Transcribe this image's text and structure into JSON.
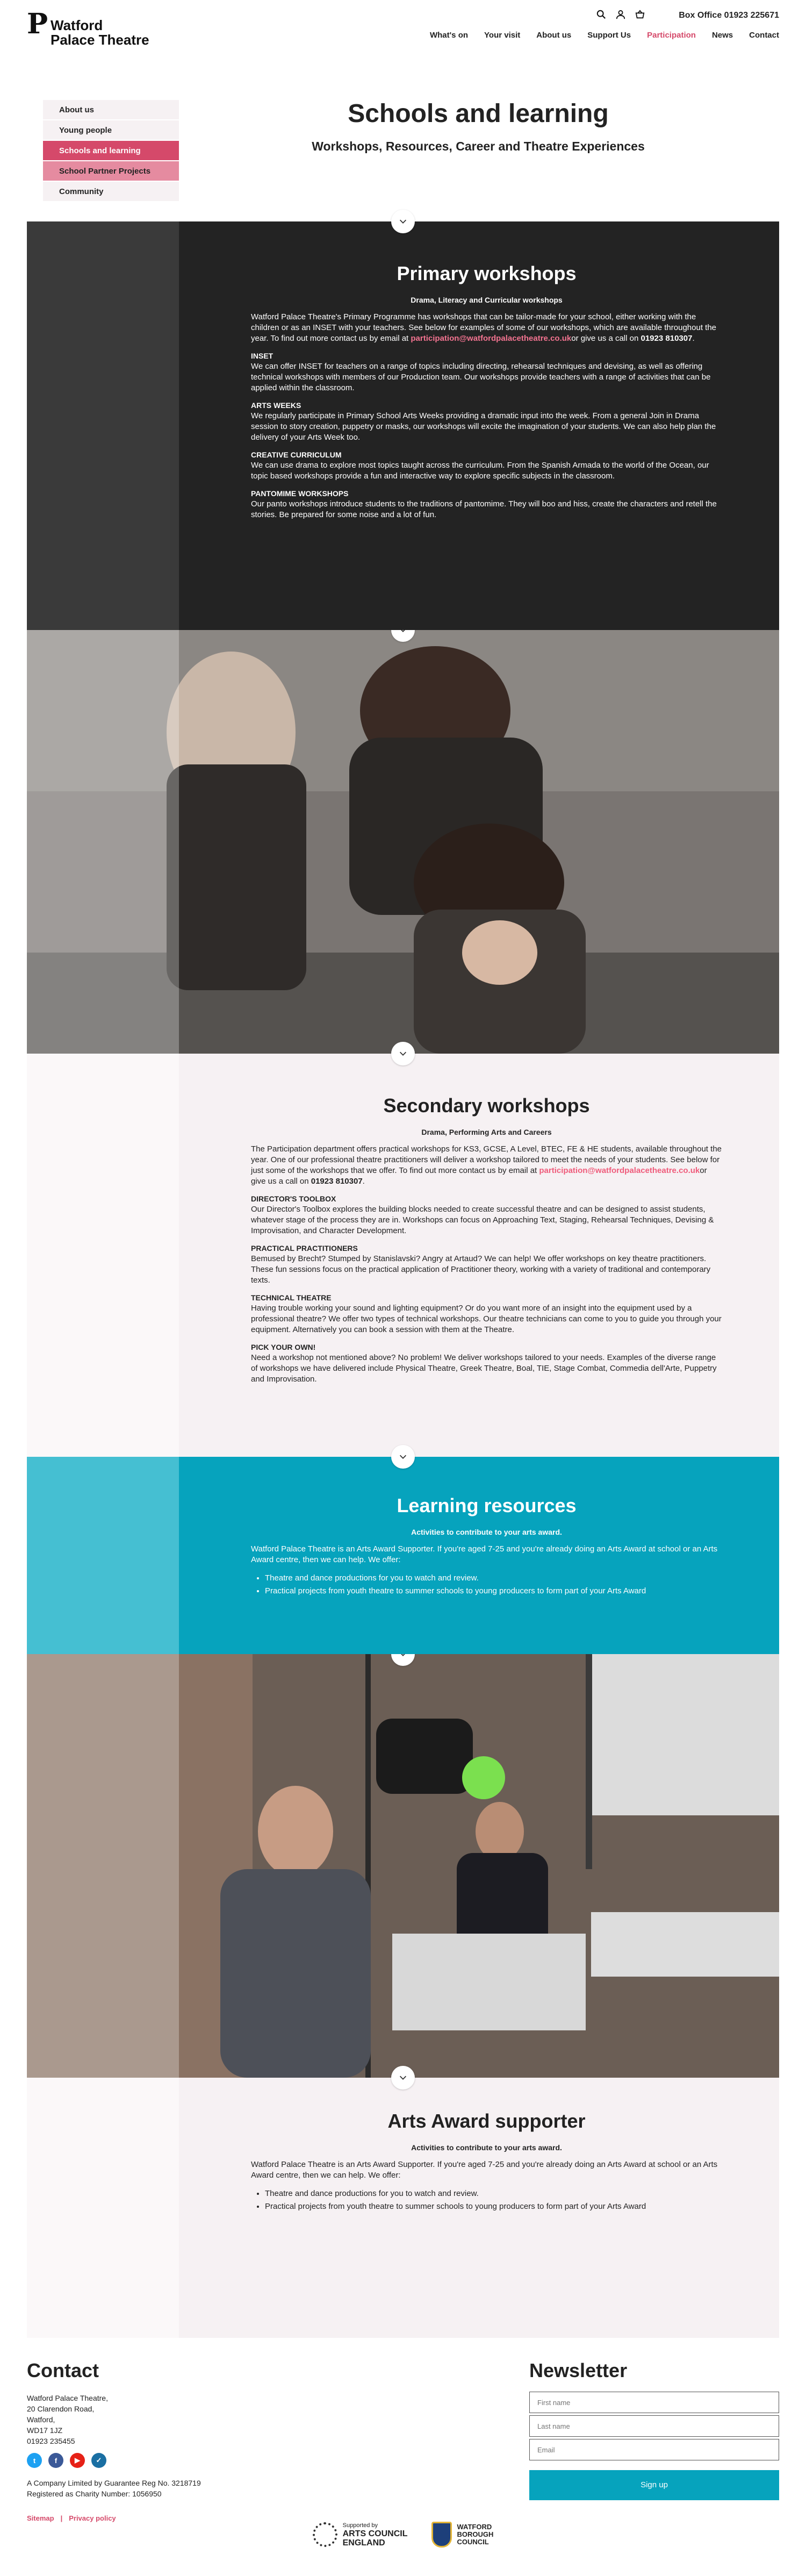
{
  "header": {
    "logo_mark": "P",
    "logo_line1": "Watford",
    "logo_line2": "Palace Theatre",
    "box_office": "Box Office 01923 225671",
    "icons": [
      "search-icon",
      "user-icon",
      "basket-icon"
    ],
    "nav": [
      "What's on",
      "Your visit",
      "About us",
      "Support Us",
      "Participation",
      "News",
      "Contact"
    ],
    "nav_active": "Participation"
  },
  "sidebar": {
    "items": [
      {
        "label": "About us",
        "state": "plain"
      },
      {
        "label": "Young people",
        "state": "plain"
      },
      {
        "label": "Schools and learning",
        "state": "active"
      },
      {
        "label": "School Partner Projects",
        "state": "pink"
      },
      {
        "label": "Community",
        "state": "plain"
      }
    ]
  },
  "page": {
    "title": "Schools and learning",
    "subtitle": "Workshops, Resources, Career and Theatre Experiences"
  },
  "primary": {
    "title": "Primary workshops",
    "subtitle": "Drama, Literacy and Curricular workshops",
    "intro": "Watford Palace Theatre's Primary Programme has workshops that can be tailor-made for your school, either working with the children or as an INSET with your teachers. See below for examples of some of our workshops, which are available throughout the year. To find out more contact us by email at ",
    "email": "participation@watfordpalacetheatre.co.uk",
    "intro_tail": "or give us a call on ",
    "phone": "01923 810307",
    "blocks": [
      {
        "h": "INSET",
        "p": "We can offer INSET for teachers on a range of topics including directing, rehearsal techniques and devising, as well as offering technical workshops with members of our Production team. Our workshops provide teachers with a range of activities that can be applied within the classroom."
      },
      {
        "h": "ARTS WEEKS",
        "p": "We regularly participate in Primary School Arts Weeks providing a dramatic input into the week. From a general Join in Drama session to story creation, puppetry or masks, our workshops will excite the imagination of your students. We can also help plan the delivery of your Arts Week too."
      },
      {
        "h": "CREATIVE CURRICULUM",
        "p": "We can use drama to explore most topics taught across the curriculum. From the Spanish Armada to the world of the Ocean, our topic based workshops provide a fun and interactive way to explore specific subjects in the classroom."
      },
      {
        "h": "PANTOMIME WORKSHOPS",
        "p": "Our panto workshops introduce students to the traditions of pantomime. They will boo and hiss, create the characters and retell the stories. Be prepared for some noise and a lot of fun."
      }
    ]
  },
  "secondary": {
    "title": "Secondary workshops",
    "subtitle": "Drama, Performing Arts and Careers",
    "intro": "The Participation department offers practical workshops for KS3, GCSE, A Level, BTEC, FE & HE students, available throughout the year. One of our professional theatre practitioners will deliver a workshop tailored to meet the needs of your students. See below for just some of the workshops that we offer. To find out more contact us by email at ",
    "email": "participation@watfordpalacetheatre.co.uk",
    "intro_tail": "or give us a call on ",
    "phone": "01923 810307",
    "blocks": [
      {
        "h": "DIRECTOR'S TOOLBOX",
        "p": "Our Director's Toolbox explores the building blocks needed to create successful theatre and can be designed to assist students, whatever stage of the process they are in. Workshops can focus on Approaching Text, Staging, Rehearsal Techniques, Devising & Improvisation, and Character Development."
      },
      {
        "h": "PRACTICAL PRACTITIONERS",
        "p": "Bemused by Brecht? Stumped by Stanislavski? Angry at Artaud? We can help! We offer workshops on key theatre practitioners. These fun sessions focus on the practical application of Practitioner theory, working with a variety of traditional and contemporary texts."
      },
      {
        "h": "TECHNICAL THEATRE",
        "p": "Having trouble working your sound and lighting equipment? Or do you want more of an insight into the equipment used by a professional theatre? We offer two types of technical workshops. Our theatre technicians can come to you to guide you through your equipment. Alternatively you can book a session with them at the Theatre."
      },
      {
        "h": "PICK YOUR OWN!",
        "p": "Need a workshop not mentioned above? No problem! We deliver workshops tailored to your needs. Examples of the diverse range of workshops we have delivered include Physical Theatre, Greek Theatre, Boal, TIE, Stage Combat, Commedia dell'Arte, Puppetry and Improvisation."
      }
    ]
  },
  "resources": {
    "title": "Learning resources",
    "subtitle": "Activities to contribute to your arts award.",
    "intro": "Watford Palace Theatre is an Arts Award Supporter. If you're aged 7-25 and you're already doing an Arts Award at school or an Arts Award centre, then we can help. We offer:",
    "bullets": [
      "Theatre and dance productions for you to watch and review.",
      "Practical projects from youth theatre to summer schools to young producers to form part of your Arts Award"
    ]
  },
  "arts_award": {
    "title": "Arts Award supporter",
    "subtitle": "Activities to contribute to your arts award.",
    "intro": "Watford Palace Theatre is an Arts Award Supporter. If you're aged 7-25 and you're already doing an Arts Award at school or an Arts Award centre, then we can help. We offer:",
    "bullets": [
      "Theatre and dance productions for you to watch and review.",
      "Practical projects from youth theatre to summer schools to young producers to form part of your Arts Award"
    ]
  },
  "footer": {
    "contact_title": "Contact",
    "address": [
      "Watford Palace Theatre,",
      "20 Clarendon Road,",
      "Watford,",
      "WD17 1JZ",
      "01923 235455"
    ],
    "social": [
      {
        "name": "twitter-icon",
        "glyph": "t",
        "color": "#1da1f2"
      },
      {
        "name": "facebook-icon",
        "glyph": "f",
        "color": "#3b5998"
      },
      {
        "name": "youtube-icon",
        "glyph": "▶",
        "color": "#e62117"
      },
      {
        "name": "tripadvisor-icon",
        "glyph": "✓",
        "color": "#1a6fa3"
      }
    ],
    "legal": [
      "A Company Limited by Guarantee Reg No. 3218719",
      "Registered as Charity Number: 1056950"
    ],
    "links": [
      "Sitemap",
      "Privacy policy"
    ],
    "newsletter_title": "Newsletter",
    "fields": [
      "First name",
      "Last name",
      "Email"
    ],
    "signup": "Sign up",
    "ace_small": "Supported by",
    "ace_line1": "ARTS COUNCIL",
    "ace_line2": "ENGLAND",
    "wbc_line1": "WATFORD",
    "wbc_line2": "BOROUGH",
    "wbc_line3": "COUNCIL"
  }
}
